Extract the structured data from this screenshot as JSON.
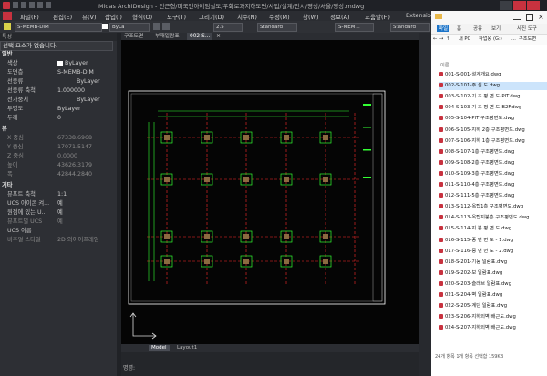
{
  "app": {
    "title": "Midas ArchiDesign - 인근형/미국인아이임실도/우회로과지하도면/사업/설계/인시/영성/서울/영상.mdwg",
    "window_controls": [
      "minimize",
      "maximize",
      "close"
    ]
  },
  "menu": [
    "파일(F)",
    "편집(E)",
    "뷰(V)",
    "삽입(I)",
    "형식(O)",
    "도구(T)",
    "그리기(D)",
    "치수(N)",
    "수정(M)",
    "창(W)",
    "정보(A)",
    "도움말(H)",
    "Extensions"
  ],
  "toolbar": {
    "layer": "S-MEMB-DIM",
    "linetype": "ByLa",
    "scale": "2.5",
    "dimstyle": "Standard",
    "dimlayer": "S-MEM...",
    "textstyle": "Standard"
  },
  "properties_panel": {
    "header": "특성",
    "selection": "선택 요소가 없습니다.",
    "sections": [
      {
        "title": "일반",
        "rows": [
          {
            "key": "색상",
            "value": "ByLayer",
            "swatch": "#ffffff"
          },
          {
            "key": "도면층",
            "value": "S-MEMB-DIM"
          },
          {
            "key": "선종류",
            "value": "ByLayer"
          },
          {
            "key": "선종류 축척",
            "value": "1.000000"
          },
          {
            "key": "선가중치",
            "value": "ByLayer"
          },
          {
            "key": "투명도",
            "value": "ByLayer"
          },
          {
            "key": "두께",
            "value": "0"
          }
        ]
      },
      {
        "title": "뷰",
        "rows": [
          {
            "key": "X 중심",
            "value": "67338.6968"
          },
          {
            "key": "Y 중심",
            "value": "17071.5147"
          },
          {
            "key": "Z 중심",
            "value": "0.0000"
          },
          {
            "key": "높이",
            "value": "43626.3179"
          },
          {
            "key": "폭",
            "value": "42844.2840"
          }
        ]
      },
      {
        "title": "기타",
        "rows": [
          {
            "key": "뷰포트 축척",
            "value": "1:1"
          },
          {
            "key": "UCS 아이콘 켜...",
            "value": "예"
          },
          {
            "key": "원점에 있는 U...",
            "value": "예"
          },
          {
            "key": "뷰포트별 UCS",
            "value": "예"
          },
          {
            "key": "UCS 이름",
            "value": ""
          },
          {
            "key": "비주얼 스타일",
            "value": "2D 와이어프레임"
          }
        ]
      }
    ]
  },
  "drawing_tabs": [
    "구조도면",
    "부재일람표",
    "002-S..."
  ],
  "layout_tabs": [
    "Model",
    "Layout1"
  ],
  "command_line": "명령:",
  "explorer": {
    "ribbon_tabs": [
      "파일",
      "홈",
      "공유",
      "보기",
      "사진 도구"
    ],
    "address": [
      "내 PC",
      "작업용 (G:)",
      "...",
      "구조도면"
    ],
    "column_header": "이름",
    "files": [
      "001-S-001-설계개요.dwg",
      "002-S-101-주 심 도.dwg",
      "003-S-102-기 초 평 면 도-PIT.dwg",
      "004-S-103-기 초 평 면 도-B2F.dwg",
      "005-S-104-PIT 구조평면도.dwg",
      "006-S-105-지하 2층 구조평면도.dwg",
      "007-S-106-지하 1층 구조평면도.dwg",
      "008-S-107-1층 구조평면도.dwg",
      "009-S-108-2층 구조평면도.dwg",
      "010-S-109-3층 구조평면도.dwg",
      "011-S-110-4층 구조평면도.dwg",
      "012-S-111-5층 구조평면도.dwg",
      "013-S-112-옥탑1층 구조평면도.dwg",
      "014-S-113-옥탑지붕층 구조평면도.dwg",
      "015-S-114-지 붕 평 면 도.dwg",
      "016-S-115-중 면 면 도 - 1.dwg",
      "017-S-116-중 면 면 도 - 2.dwg",
      "018-S-201-기둥 일람표.dwg",
      "019-S-202-보 일람표.dwg",
      "020-S-203-슬래브 일람표.dwg",
      "021-S-204-벽 일람표.dwg",
      "022-S-205-계단 일람표.dwg",
      "023-S-206-지하외벽 배근도.dwg",
      "024-S-207-지하외벽 배근도.dwg"
    ],
    "selected_index": 1,
    "status": "24개 항목    1개 항목 선택함 159KB"
  },
  "colors": {
    "accent_red": "#c8323f",
    "drawing_green": "#33ff33",
    "drawing_red": "#ff2a2a",
    "explorer_blue": "#1a73c8"
  }
}
